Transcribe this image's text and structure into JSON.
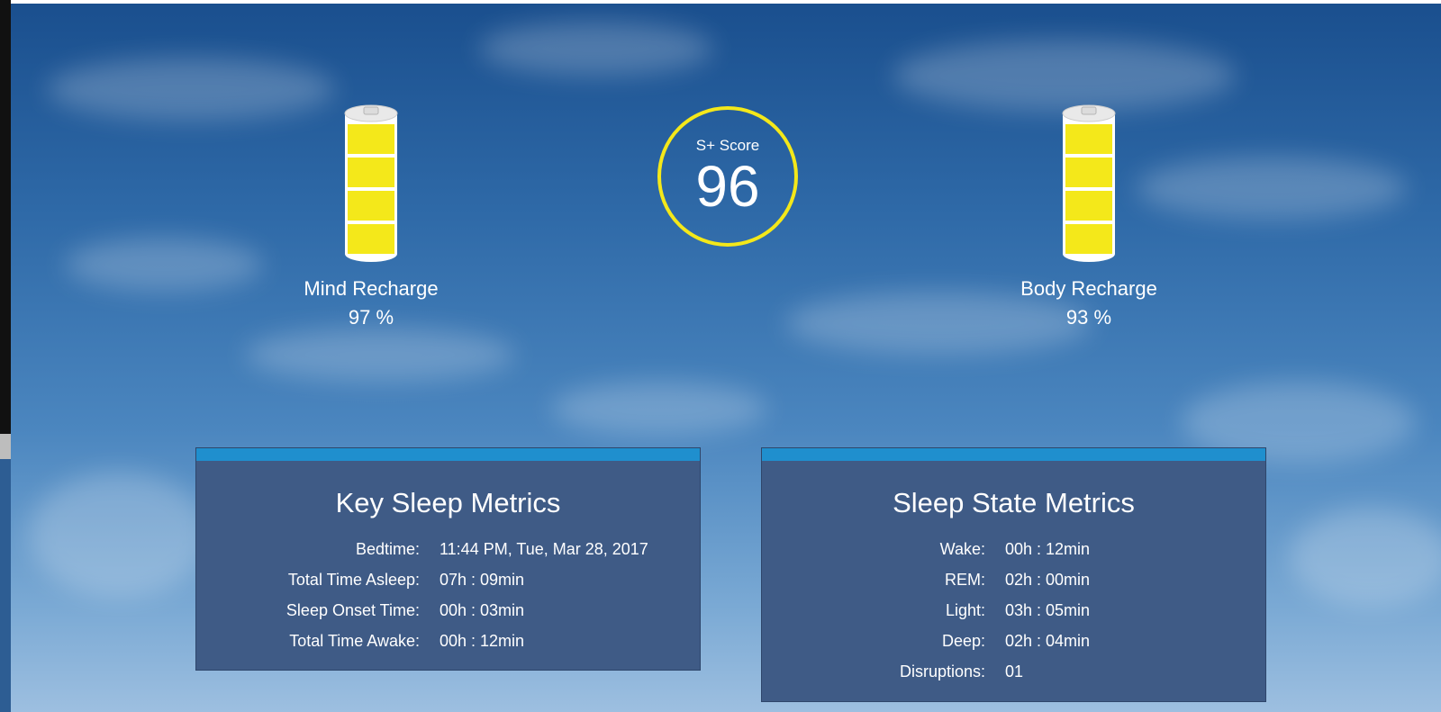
{
  "mind_recharge": {
    "label": "Mind Recharge",
    "value": "97 %",
    "level": 0.97
  },
  "body_recharge": {
    "label": "Body Recharge",
    "value": "93 %",
    "level": 0.93
  },
  "score": {
    "label": "S+ Score",
    "value": "96"
  },
  "key_sleep_metrics": {
    "title": "Key Sleep Metrics",
    "rows": [
      {
        "label": "Bedtime:",
        "value": "11:44 PM, Tue, Mar 28, 2017"
      },
      {
        "label": "Total Time Asleep:",
        "value": "07h : 09min"
      },
      {
        "label": "Sleep Onset Time:",
        "value": "00h : 03min"
      },
      {
        "label": "Total Time Awake:",
        "value": "00h : 12min"
      }
    ]
  },
  "sleep_state_metrics": {
    "title": "Sleep State Metrics",
    "rows": [
      {
        "label": "Wake:",
        "value": "00h : 12min"
      },
      {
        "label": "REM:",
        "value": "02h : 00min"
      },
      {
        "label": "Light:",
        "value": "03h : 05min"
      },
      {
        "label": "Deep:",
        "value": "02h : 04min"
      },
      {
        "label": "Disruptions:",
        "value": "01"
      }
    ]
  },
  "colors": {
    "battery_fill": "#f4e81a",
    "score_ring": "#f4e81a",
    "panel_bg": "#3f5b86",
    "panel_bar": "#1f8fce"
  }
}
